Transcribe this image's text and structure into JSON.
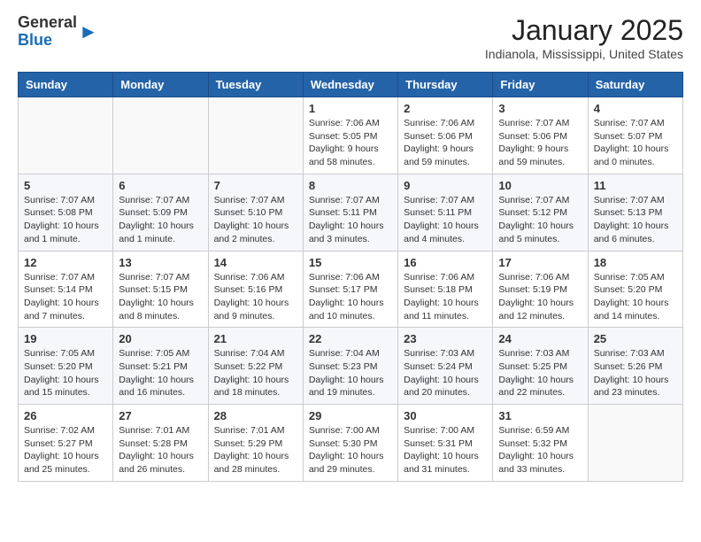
{
  "header": {
    "logo_general": "General",
    "logo_blue": "Blue",
    "month_title": "January 2025",
    "subtitle": "Indianola, Mississippi, United States"
  },
  "days_of_week": [
    "Sunday",
    "Monday",
    "Tuesday",
    "Wednesday",
    "Thursday",
    "Friday",
    "Saturday"
  ],
  "weeks": [
    [
      {
        "day": "",
        "info": ""
      },
      {
        "day": "",
        "info": ""
      },
      {
        "day": "",
        "info": ""
      },
      {
        "day": "1",
        "info": "Sunrise: 7:06 AM\nSunset: 5:05 PM\nDaylight: 9 hours\nand 58 minutes."
      },
      {
        "day": "2",
        "info": "Sunrise: 7:06 AM\nSunset: 5:06 PM\nDaylight: 9 hours\nand 59 minutes."
      },
      {
        "day": "3",
        "info": "Sunrise: 7:07 AM\nSunset: 5:06 PM\nDaylight: 9 hours\nand 59 minutes."
      },
      {
        "day": "4",
        "info": "Sunrise: 7:07 AM\nSunset: 5:07 PM\nDaylight: 10 hours\nand 0 minutes."
      }
    ],
    [
      {
        "day": "5",
        "info": "Sunrise: 7:07 AM\nSunset: 5:08 PM\nDaylight: 10 hours\nand 1 minute."
      },
      {
        "day": "6",
        "info": "Sunrise: 7:07 AM\nSunset: 5:09 PM\nDaylight: 10 hours\nand 1 minute."
      },
      {
        "day": "7",
        "info": "Sunrise: 7:07 AM\nSunset: 5:10 PM\nDaylight: 10 hours\nand 2 minutes."
      },
      {
        "day": "8",
        "info": "Sunrise: 7:07 AM\nSunset: 5:11 PM\nDaylight: 10 hours\nand 3 minutes."
      },
      {
        "day": "9",
        "info": "Sunrise: 7:07 AM\nSunset: 5:11 PM\nDaylight: 10 hours\nand 4 minutes."
      },
      {
        "day": "10",
        "info": "Sunrise: 7:07 AM\nSunset: 5:12 PM\nDaylight: 10 hours\nand 5 minutes."
      },
      {
        "day": "11",
        "info": "Sunrise: 7:07 AM\nSunset: 5:13 PM\nDaylight: 10 hours\nand 6 minutes."
      }
    ],
    [
      {
        "day": "12",
        "info": "Sunrise: 7:07 AM\nSunset: 5:14 PM\nDaylight: 10 hours\nand 7 minutes."
      },
      {
        "day": "13",
        "info": "Sunrise: 7:07 AM\nSunset: 5:15 PM\nDaylight: 10 hours\nand 8 minutes."
      },
      {
        "day": "14",
        "info": "Sunrise: 7:06 AM\nSunset: 5:16 PM\nDaylight: 10 hours\nand 9 minutes."
      },
      {
        "day": "15",
        "info": "Sunrise: 7:06 AM\nSunset: 5:17 PM\nDaylight: 10 hours\nand 10 minutes."
      },
      {
        "day": "16",
        "info": "Sunrise: 7:06 AM\nSunset: 5:18 PM\nDaylight: 10 hours\nand 11 minutes."
      },
      {
        "day": "17",
        "info": "Sunrise: 7:06 AM\nSunset: 5:19 PM\nDaylight: 10 hours\nand 12 minutes."
      },
      {
        "day": "18",
        "info": "Sunrise: 7:05 AM\nSunset: 5:20 PM\nDaylight: 10 hours\nand 14 minutes."
      }
    ],
    [
      {
        "day": "19",
        "info": "Sunrise: 7:05 AM\nSunset: 5:20 PM\nDaylight: 10 hours\nand 15 minutes."
      },
      {
        "day": "20",
        "info": "Sunrise: 7:05 AM\nSunset: 5:21 PM\nDaylight: 10 hours\nand 16 minutes."
      },
      {
        "day": "21",
        "info": "Sunrise: 7:04 AM\nSunset: 5:22 PM\nDaylight: 10 hours\nand 18 minutes."
      },
      {
        "day": "22",
        "info": "Sunrise: 7:04 AM\nSunset: 5:23 PM\nDaylight: 10 hours\nand 19 minutes."
      },
      {
        "day": "23",
        "info": "Sunrise: 7:03 AM\nSunset: 5:24 PM\nDaylight: 10 hours\nand 20 minutes."
      },
      {
        "day": "24",
        "info": "Sunrise: 7:03 AM\nSunset: 5:25 PM\nDaylight: 10 hours\nand 22 minutes."
      },
      {
        "day": "25",
        "info": "Sunrise: 7:03 AM\nSunset: 5:26 PM\nDaylight: 10 hours\nand 23 minutes."
      }
    ],
    [
      {
        "day": "26",
        "info": "Sunrise: 7:02 AM\nSunset: 5:27 PM\nDaylight: 10 hours\nand 25 minutes."
      },
      {
        "day": "27",
        "info": "Sunrise: 7:01 AM\nSunset: 5:28 PM\nDaylight: 10 hours\nand 26 minutes."
      },
      {
        "day": "28",
        "info": "Sunrise: 7:01 AM\nSunset: 5:29 PM\nDaylight: 10 hours\nand 28 minutes."
      },
      {
        "day": "29",
        "info": "Sunrise: 7:00 AM\nSunset: 5:30 PM\nDaylight: 10 hours\nand 29 minutes."
      },
      {
        "day": "30",
        "info": "Sunrise: 7:00 AM\nSunset: 5:31 PM\nDaylight: 10 hours\nand 31 minutes."
      },
      {
        "day": "31",
        "info": "Sunrise: 6:59 AM\nSunset: 5:32 PM\nDaylight: 10 hours\nand 33 minutes."
      },
      {
        "day": "",
        "info": ""
      }
    ]
  ]
}
